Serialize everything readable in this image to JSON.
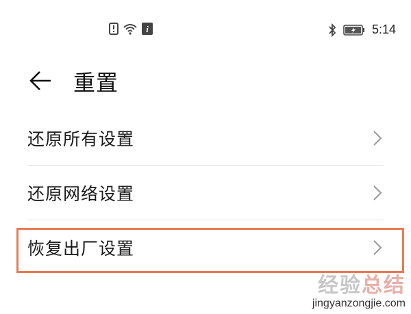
{
  "status_bar": {
    "time": "5:14",
    "left_icons": [
      "notification-alert-icon",
      "wifi-icon",
      "info-icon"
    ],
    "right_icons": [
      "bluetooth-icon",
      "battery-charging-icon"
    ]
  },
  "header": {
    "title": "重置",
    "back_icon": "arrow-left-icon"
  },
  "settings_list": {
    "items": [
      {
        "label": "还原所有设置"
      },
      {
        "label": "还原网络设置"
      },
      {
        "label": "恢复出厂设置"
      }
    ],
    "highlight_color": "#e87a52"
  },
  "watermark": {
    "title_part1": "经验",
    "title_part2": "总结",
    "url": "jingyanzongjie.com"
  }
}
